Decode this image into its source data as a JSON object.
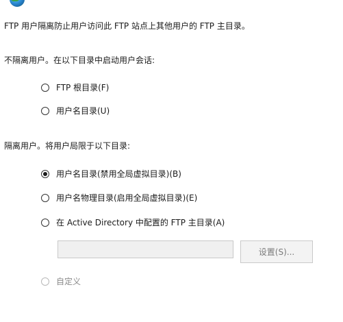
{
  "description": {
    "text": "FTP 用户隔离防止用户访问此 FTP 站点上其他用户的 FTP 主目录。"
  },
  "no_isolation": {
    "heading": "不隔离用户。在以下目录中启动用户会话:",
    "options": [
      {
        "label": "FTP 根目录(F)",
        "selected": false,
        "enabled": true
      },
      {
        "label": "用户名目录(U)",
        "selected": false,
        "enabled": true
      }
    ]
  },
  "isolation": {
    "heading": "隔离用户。将用户局限于以下目录:",
    "options": [
      {
        "label": "用户名目录(禁用全局虚拟目录)(B)",
        "selected": true,
        "enabled": true
      },
      {
        "label": "用户名物理目录(启用全局虚拟目录)(E)",
        "selected": false,
        "enabled": true
      },
      {
        "label": "在 Active Directory 中配置的 FTP 主目录(A)",
        "selected": false,
        "enabled": true
      }
    ],
    "ad_path_value": "",
    "settings_button": "设置(S)...",
    "custom_option": {
      "label": "自定义",
      "selected": false,
      "enabled": false
    }
  }
}
